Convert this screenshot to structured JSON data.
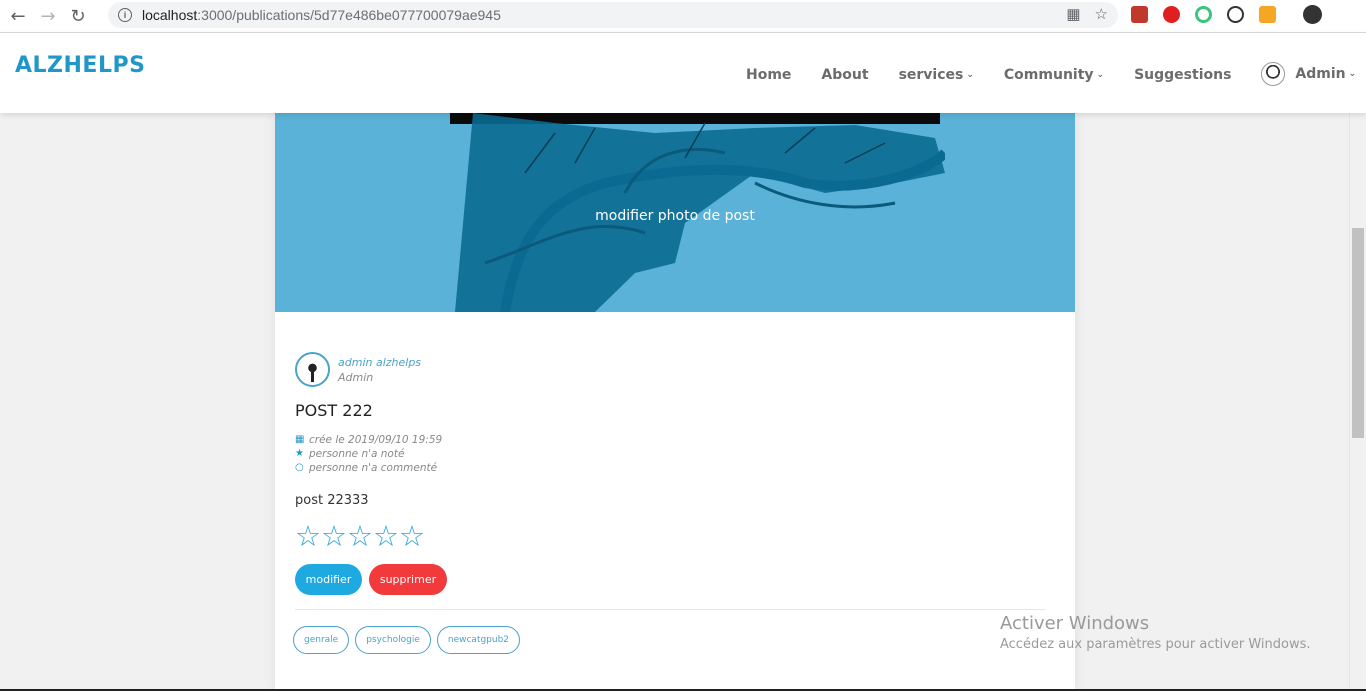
{
  "browser": {
    "url_host": "localhost",
    "url_path": ":3000/publications/5d77e486be077700079ae945"
  },
  "site": {
    "brand": "ALZHELPS",
    "nav": [
      {
        "label": "Home",
        "caret": false
      },
      {
        "label": "About",
        "caret": false
      },
      {
        "label": "services",
        "caret": true
      },
      {
        "label": "Community",
        "caret": true
      },
      {
        "label": "Suggestions",
        "caret": false
      }
    ],
    "user_label": "Admin"
  },
  "post": {
    "cover_label": "modifier photo de post",
    "author_name": "admin alzhelps",
    "author_role": "Admin",
    "title": "POST 222",
    "created": "crée le 2019/09/10 19:59",
    "rating_note": "personne n'a noté",
    "comment_note": "personne n'a commenté",
    "body": "post 22333",
    "rating": 0,
    "max_rating": 5,
    "edit_label": "modifier",
    "delete_label": "supprimer",
    "tags": [
      "genrale",
      "psychologie",
      "newcatgpub2"
    ]
  },
  "watermark": {
    "title": "Activer Windows",
    "subtitle": "Accédez aux paramètres pour activer Windows."
  },
  "colors": {
    "brand": "#1f97c9",
    "hero": "#5ab2d8",
    "edit": "#1fa9e1",
    "delete": "#f23a3c"
  },
  "icons": [
    "back-arrow-icon",
    "forward-arrow-icon",
    "reload-icon",
    "info-icon",
    "translate-icon",
    "star-bookmark-icon",
    "calendar-icon",
    "star-icon",
    "comment-icon"
  ]
}
